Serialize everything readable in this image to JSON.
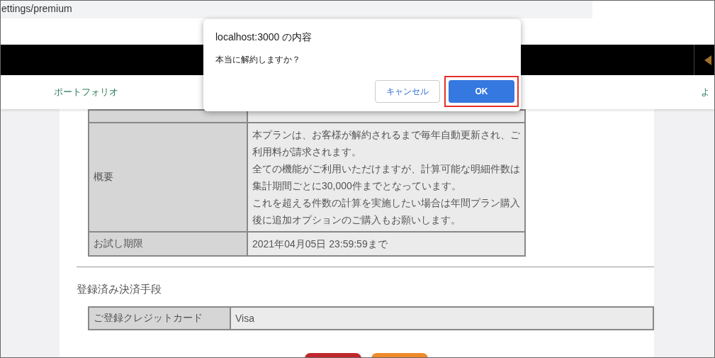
{
  "browser": {
    "url": "ettings/premium"
  },
  "nav": {
    "items": [
      {
        "label": "ポートフォリオ"
      },
      {
        "label": "よ"
      }
    ]
  },
  "plan_table": {
    "rows": [
      {
        "label": "概要",
        "paragraphs": [
          "本プランは、お客様が解約されるまで毎年自動更新され、ご利用料が請求されます。",
          "全ての機能がご利用いただけますが、計算可能な明細件数は集計期間ごとに30,000件までとなっています。",
          "これを超える件数の計算を実施したい場合は年間プラン購入後に追加オプションのご購入もお願いします。"
        ]
      },
      {
        "label": "お試し期限",
        "paragraphs": [
          "2021年04月05日 23:59:59まで"
        ]
      }
    ]
  },
  "payment": {
    "heading": "登録済み決済手段",
    "rows": [
      {
        "label": "ご登録クレジットカード",
        "value": "Visa"
      }
    ]
  },
  "dialog": {
    "title": "localhost:3000 の内容",
    "message": "本当に解約しますか？",
    "buttons": [
      {
        "label": "キャンセル",
        "kind": "secondary",
        "highlighted": false
      },
      {
        "label": "OK",
        "kind": "primary",
        "highlighted": true
      }
    ]
  }
}
